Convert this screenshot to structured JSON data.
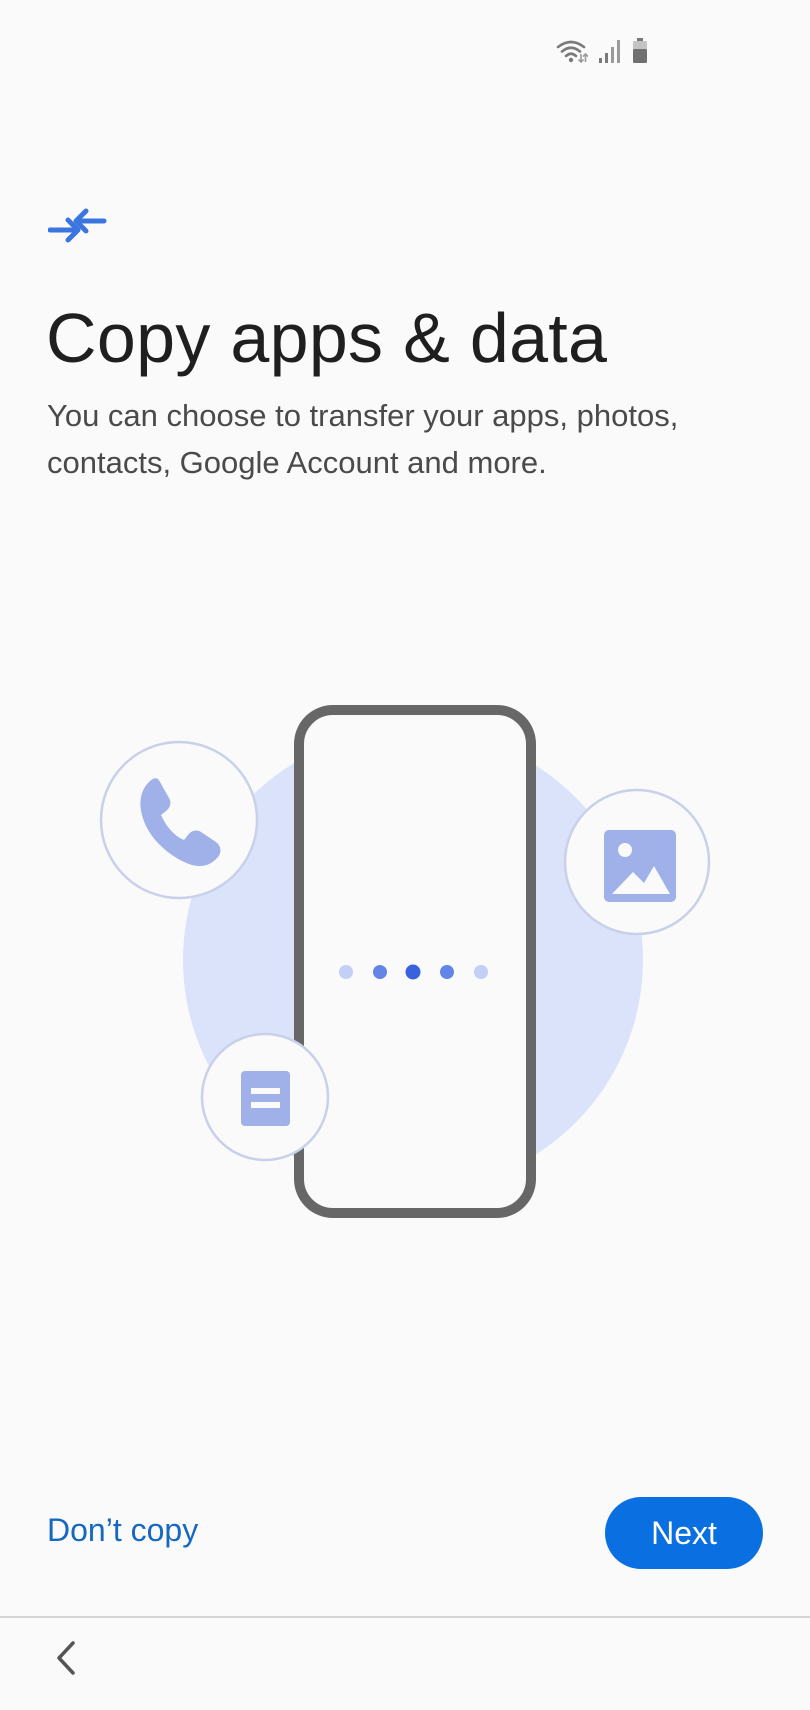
{
  "status_bar": {
    "icons": [
      "wifi-icon",
      "signal-icon",
      "battery-icon"
    ]
  },
  "header": {
    "icon": "transfer-arrows-icon",
    "title": "Copy apps & data",
    "subtitle": "You can choose to transfer your apps, photos, contacts, Google Account and more."
  },
  "illustration": {
    "items": [
      "phone-call-icon",
      "image-icon",
      "document-icon"
    ],
    "progress_dots": 5,
    "colors": {
      "accent": "#a0b0e8",
      "circle_bg": "#dbe3fb",
      "phone_frame": "#676767",
      "dot_active": "#4068e0"
    }
  },
  "actions": {
    "dont_copy_label": "Don’t copy",
    "next_label": "Next"
  },
  "navigation": {
    "back_icon": "back-chevron-icon"
  },
  "colors": {
    "link": "#1668c1",
    "primary_button": "#0a6fe0",
    "background": "#fafafa"
  }
}
